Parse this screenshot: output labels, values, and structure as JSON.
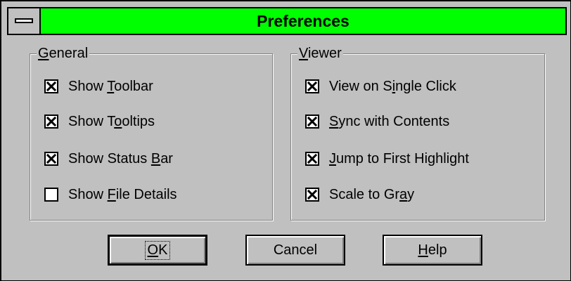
{
  "window": {
    "title": "Preferences",
    "titlebar_color": "#00ff00"
  },
  "general": {
    "legend_prefix": "",
    "legend_mnemonic": "G",
    "legend_suffix": "eneral",
    "options": [
      {
        "pre": "Show ",
        "mn": "T",
        "post": "oolbar",
        "checked": true
      },
      {
        "pre": "Show T",
        "mn": "o",
        "post": "oltips",
        "checked": true
      },
      {
        "pre": "Show Status ",
        "mn": "B",
        "post": "ar",
        "checked": true
      },
      {
        "pre": "Show ",
        "mn": "F",
        "post": "ile Details",
        "checked": false
      }
    ]
  },
  "viewer": {
    "legend_prefix": "",
    "legend_mnemonic": "V",
    "legend_suffix": "iewer",
    "options": [
      {
        "pre": "View on S",
        "mn": "i",
        "post": "ngle Click",
        "checked": true
      },
      {
        "pre": "",
        "mn": "S",
        "post": "ync with Contents",
        "checked": true
      },
      {
        "pre": "",
        "mn": "J",
        "post": "ump to First Highlight",
        "checked": true
      },
      {
        "pre": "Scale to Gr",
        "mn": "a",
        "post": "y",
        "checked": true
      }
    ]
  },
  "buttons": {
    "ok": {
      "pre": "",
      "mn": "O",
      "post": "K"
    },
    "cancel": {
      "label": "Cancel"
    },
    "help": {
      "pre": "",
      "mn": "H",
      "post": "elp"
    }
  }
}
